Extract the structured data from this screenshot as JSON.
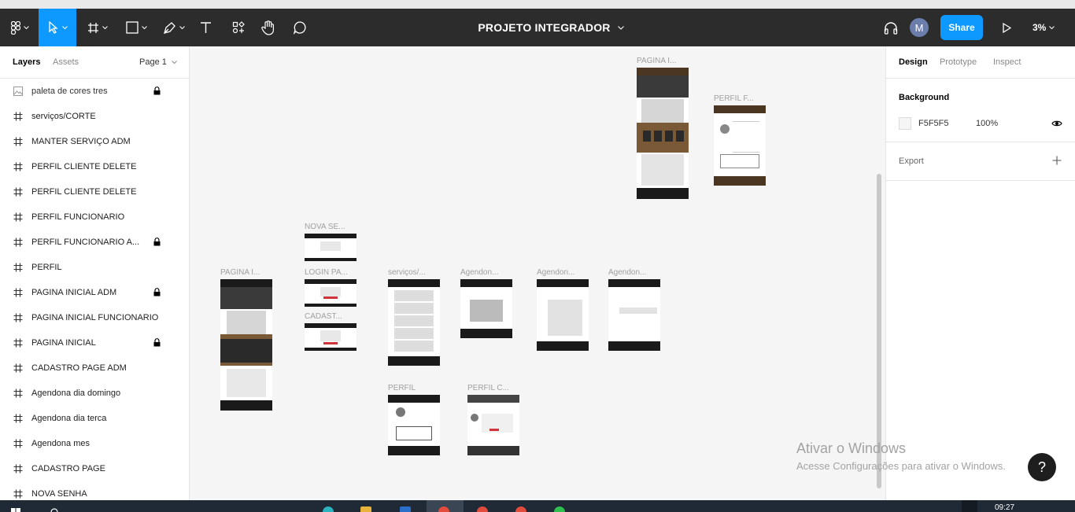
{
  "toolbar": {
    "file_title": "PROJETO INTEGRADOR",
    "avatar_initial": "M",
    "share_label": "Share",
    "zoom_label": "3%"
  },
  "left_panel": {
    "tabs": [
      "Layers",
      "Assets"
    ],
    "page_selector": "Page 1",
    "layers": [
      {
        "name": "paleta de cores tres",
        "icon": "image-icon",
        "locked": true
      },
      {
        "name": "serviços/CORTE",
        "icon": "frame-icon",
        "locked": false
      },
      {
        "name": "MANTER SERVIÇO ADM",
        "icon": "frame-icon",
        "locked": false
      },
      {
        "name": "PERFIL CLIENTE DELETE",
        "icon": "frame-icon",
        "locked": false
      },
      {
        "name": "PERFIL CLIENTE DELETE",
        "icon": "frame-icon",
        "locked": false
      },
      {
        "name": "PERFIL FUNCIONARIO",
        "icon": "frame-icon",
        "locked": false
      },
      {
        "name": "PERFIL FUNCIONARIO A...",
        "icon": "frame-icon",
        "locked": true
      },
      {
        "name": "PERFIL",
        "icon": "frame-icon",
        "locked": false
      },
      {
        "name": "PAGINA INICIAL ADM",
        "icon": "frame-icon",
        "locked": true
      },
      {
        "name": "PAGINA INICIAL FUNCIONARIO",
        "icon": "frame-icon",
        "locked": false
      },
      {
        "name": "PAGINA INICIAL",
        "icon": "frame-icon",
        "locked": true
      },
      {
        "name": "CADASTRO PAGE ADM",
        "icon": "frame-icon",
        "locked": false
      },
      {
        "name": "Agendona dia domingo",
        "icon": "frame-icon",
        "locked": false
      },
      {
        "name": "Agendona dia terca",
        "icon": "frame-icon",
        "locked": false
      },
      {
        "name": "Agendona mes",
        "icon": "frame-icon",
        "locked": false
      },
      {
        "name": "CADASTRO PAGE",
        "icon": "frame-icon",
        "locked": false
      },
      {
        "name": "NOVA SENHA",
        "icon": "frame-icon",
        "locked": false
      }
    ]
  },
  "right_panel": {
    "tabs": [
      "Design",
      "Prototype",
      "Inspect"
    ],
    "background_label": "Background",
    "background_hex": "F5F5F5",
    "background_opacity": "100%",
    "export_label": "Export"
  },
  "canvas": {
    "frame_labels": {
      "pagina_top": "PAGINA I...",
      "perfil_f": "PERFIL F...",
      "nova_se": "NOVA SE...",
      "pagina_left": "PAGINA I...",
      "login_pa": "LOGIN PA...",
      "cadast": "CADAST...",
      "servicos": "serviços/...",
      "agendon1": "Agendon...",
      "agendon2": "Agendon...",
      "agendon3": "Agendon...",
      "perfil": "PERFIL",
      "perfil_c": "PERFIL C..."
    }
  },
  "watermark": {
    "line1": "Ativar o Windows",
    "line2": "Acesse Configurações para ativar o Windows."
  },
  "help_label": "?",
  "taskbar": {
    "time": "09:27"
  },
  "colors": {
    "accent": "#0d99ff",
    "toolbar_bg": "#2c2c2c",
    "canvas_bg": "#f5f5f5",
    "frame_dark": "#1a1a1a",
    "frame_brown": "#4b3621"
  }
}
